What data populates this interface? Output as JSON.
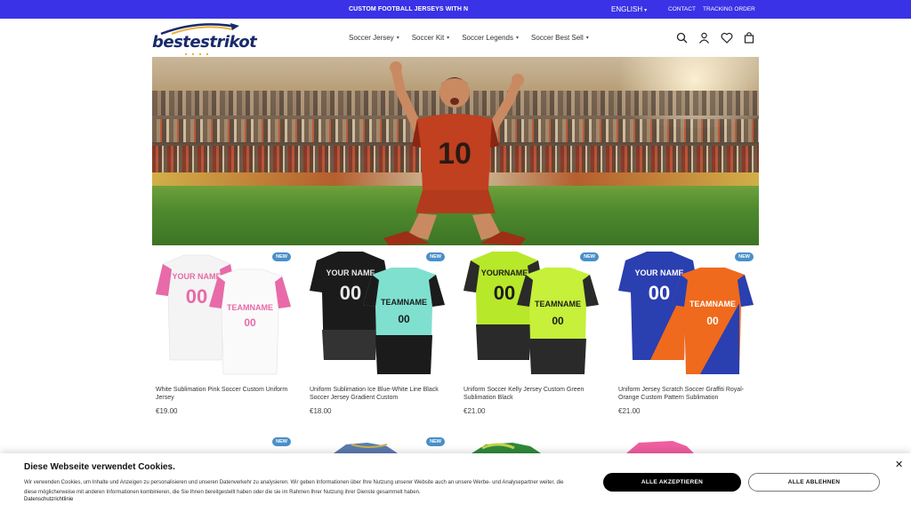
{
  "topbar": {
    "announcement": "CUSTOM FOOTBALL JERSEYS WITH N",
    "language": "ENGLISH",
    "contact": "CONTACT",
    "tracking": "TRACKING ORDER",
    "bg_color": "#3a32e6"
  },
  "header": {
    "logo_text": "bestestrikot",
    "nav": [
      {
        "label": "Soccer Jersey"
      },
      {
        "label": "Soccer Kit"
      },
      {
        "label": "Soccer Legends"
      },
      {
        "label": "Soccer Best Sell"
      }
    ],
    "icons": [
      "search-icon",
      "account-icon",
      "wishlist-icon",
      "cart-icon"
    ]
  },
  "hero": {
    "jersey_number": "10"
  },
  "products": [
    {
      "badge": "NEW",
      "name": "White Sublimation Pink Soccer Custom Uniform Jersey",
      "price": "€19.00",
      "colors": [
        "#ffffff",
        "#e86aa8"
      ],
      "front_text": "YOUR NAME",
      "back_text": "TEAMNAME",
      "number": "00"
    },
    {
      "badge": "NEW",
      "name": "Uniform Sublimation Ice Blue-White Line Black Soccer Jersey Gradient Custom",
      "price": "€18.00",
      "colors": [
        "#1b1b1b",
        "#7fe0d0"
      ],
      "front_text": "YOUR NAME",
      "back_text": "TEAMNAME",
      "number": "00"
    },
    {
      "badge": "NEW",
      "name": "Uniform Soccer Kelly Jersey Custom Green Sublimation Black",
      "price": "€21.00",
      "colors": [
        "#2a2a2a",
        "#b8e82a"
      ],
      "front_text": "YOURNAME",
      "back_text": "TEAMNAME",
      "number": "00"
    },
    {
      "badge": "NEW",
      "name": "Uniform Jersey Scratch Soccer Graffiti Royal-Orange Custom Pattern Sublimation",
      "price": "€21.00",
      "colors": [
        "#2a3fb0",
        "#ef6a1c"
      ],
      "front_text": "YOUR NAME",
      "back_text": "TEAMNAME",
      "number": "00"
    }
  ],
  "products_row2": [
    {
      "badge": "NEW"
    },
    {
      "badge": "NEW"
    }
  ],
  "cookie": {
    "title": "Diese Webseite verwendet Cookies.",
    "text": "Wir verwenden Cookies, um Inhalte und Anzeigen zu personalisieren und unseren Datenverkehr zu analysieren. Wir geben Informationen über Ihre Nutzung unserer Website auch an unsere Werbe- und Analysepartner weiter, die diese möglicherweise mit anderen Informationen kombinieren, die Sie Ihnen bereitgestellt haben oder die sie im Rahmen Ihrer Nutzung ihrer Dienste gesammelt haben.",
    "privacy_link": "Datenschutzrichtlinie",
    "accept_label": "ALLE AKZEPTIEREN",
    "reject_label": "ALLE ABLEHNEN",
    "close_symbol": "✕"
  }
}
